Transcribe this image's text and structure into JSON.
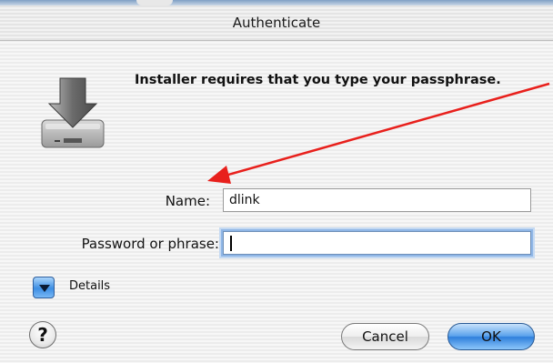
{
  "window": {
    "title": "Authenticate"
  },
  "icons": {
    "app": "hard-drive-download-icon",
    "help": "help-icon",
    "disclosure": "disclosure-triangle-icon"
  },
  "message": "Installer requires that you type your passphrase.",
  "form": {
    "name_label": "Name:",
    "name_value": "dlink",
    "password_label": "Password or phrase:",
    "password_value": ""
  },
  "details": {
    "label": "Details"
  },
  "help": {
    "glyph": "?"
  },
  "buttons": {
    "cancel": "Cancel",
    "ok": "OK"
  },
  "colors": {
    "annotation_arrow": "#e8201c",
    "focus_ring": "#8fb6e6",
    "ok_button": "#3d8ee3"
  }
}
